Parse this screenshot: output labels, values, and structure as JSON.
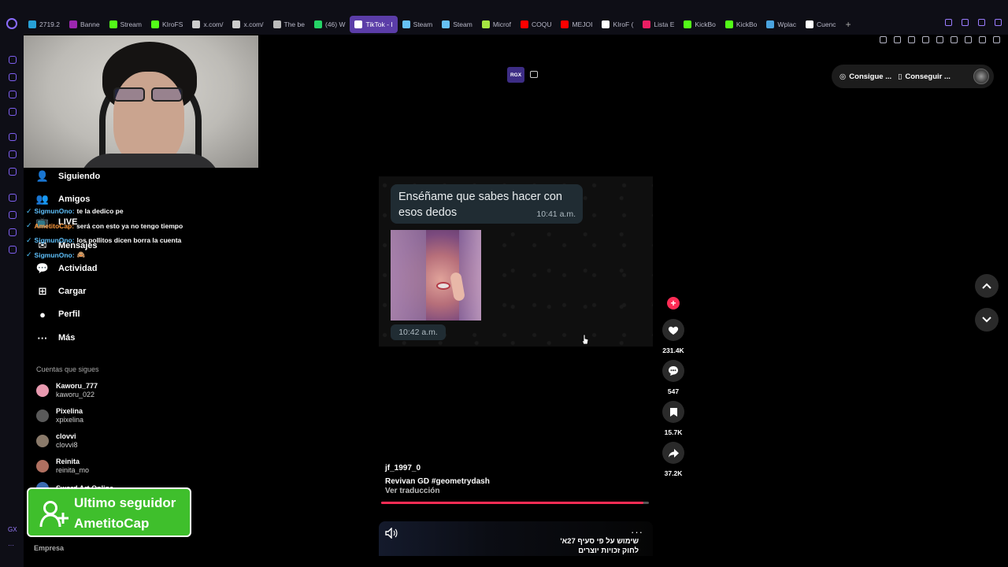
{
  "browser": {
    "tabs": [
      {
        "label": "2719.2",
        "color": "#27a0d6"
      },
      {
        "label": "Banne",
        "color": "#9c27b0"
      },
      {
        "label": "Stream",
        "color": "#53fc18"
      },
      {
        "label": "KIroFS",
        "color": "#53fc18"
      },
      {
        "label": "x.com/",
        "color": "#cccccc"
      },
      {
        "label": "x.com/",
        "color": "#cccccc"
      },
      {
        "label": "The be",
        "color": "#bbbbbb"
      },
      {
        "label": "(46) W",
        "color": "#25d366"
      },
      {
        "label": "TikTok - I",
        "color": "#ffffff",
        "active": true
      },
      {
        "label": "Steam",
        "color": "#66c0f4"
      },
      {
        "label": "Steam",
        "color": "#66c0f4"
      },
      {
        "label": "Microf",
        "color": "#a4e542"
      },
      {
        "label": "COQU",
        "color": "#ff0000"
      },
      {
        "label": "MEJOI",
        "color": "#ff0000"
      },
      {
        "label": "KIroF (",
        "color": "#ffffff"
      },
      {
        "label": "Lista E",
        "color": "#e91e63"
      },
      {
        "label": "KickBo",
        "color": "#53fc18"
      },
      {
        "label": "KickBo",
        "color": "#53fc18"
      },
      {
        "label": "Wplac",
        "color": "#4aa3df"
      },
      {
        "label": "Cuenc",
        "color": "#ffffff"
      }
    ],
    "new_tab": "+"
  },
  "sidebar_text": {
    "gx": "GX",
    "more": "···"
  },
  "nav": {
    "items": [
      {
        "label": "Siguiendo",
        "icon": "person-follow-icon",
        "glyph": "👤"
      },
      {
        "label": "Amigos",
        "icon": "friends-icon",
        "glyph": "👥"
      },
      {
        "label": "LIVE",
        "icon": "live-icon",
        "glyph": "📺"
      },
      {
        "label": "Mensajes",
        "icon": "messages-icon",
        "glyph": "✉"
      },
      {
        "label": "Actividad",
        "icon": "activity-icon",
        "glyph": "💬"
      },
      {
        "label": "Cargar",
        "icon": "upload-icon",
        "glyph": "⊞"
      },
      {
        "label": "Perfil",
        "icon": "profile-icon",
        "glyph": "●"
      },
      {
        "label": "Más",
        "icon": "more-icon",
        "glyph": "···"
      }
    ],
    "follows_title": "Cuentas que sigues",
    "accounts": [
      {
        "name": "Kaworu_777",
        "handle": "kaworu_022",
        "color": "#e89ab0"
      },
      {
        "name": "Pixelina",
        "handle": "xpixelina",
        "color": "#5a5a5a"
      },
      {
        "name": "clovvi",
        "handle": "clovvi8",
        "color": "#8a7a6a"
      },
      {
        "name": "Reinita",
        "handle": "reinita_mo",
        "color": "#b07060"
      },
      {
        "name": "Sword Art Online",
        "handle": "",
        "color": "#3a6ab0"
      }
    ],
    "footer": "Empresa"
  },
  "chat": [
    {
      "user": "SigmunOno:",
      "msg": "te la dedico pe",
      "alt": false
    },
    {
      "user": "AmetitoCap:",
      "msg": "será con esto ya no tengo tiempo",
      "alt": true
    },
    {
      "user": "SigmunOno:",
      "msg": "los pollitos dicen borra la cuenta",
      "alt": false
    },
    {
      "user": "SigmunOno:",
      "msg": "🙈",
      "alt": false
    }
  ],
  "alert": {
    "line1": "Ultimo seguidor",
    "line2": "AmetitoCap"
  },
  "badges": {
    "rgx": "RGX"
  },
  "topright": {
    "get_coins": "Consigue ...",
    "get_app": "Conseguir ..."
  },
  "video": {
    "message": "Enséñame que sabes hacer con esos dedos",
    "message_time": "10:41 a.m.",
    "photo_time": "10:42 a.m."
  },
  "actions": {
    "likes": "231.4K",
    "comments": "547",
    "saves": "15.7K",
    "shares": "37.2K"
  },
  "caption": {
    "user": "jf_1997_0",
    "desc": "Revivan GD #geometrydash",
    "translate": "Ver traducción"
  },
  "progress": 0.98,
  "next_video": {
    "more": "···",
    "hebrew_line1": "שימוש על פי סעיף 27א'",
    "hebrew_line2": "לחוק זכויות יוצרים"
  },
  "colors": {
    "accent": "#fe2c55",
    "alert_green": "#3fbf2c",
    "opera_purple": "#7e5ff0"
  }
}
